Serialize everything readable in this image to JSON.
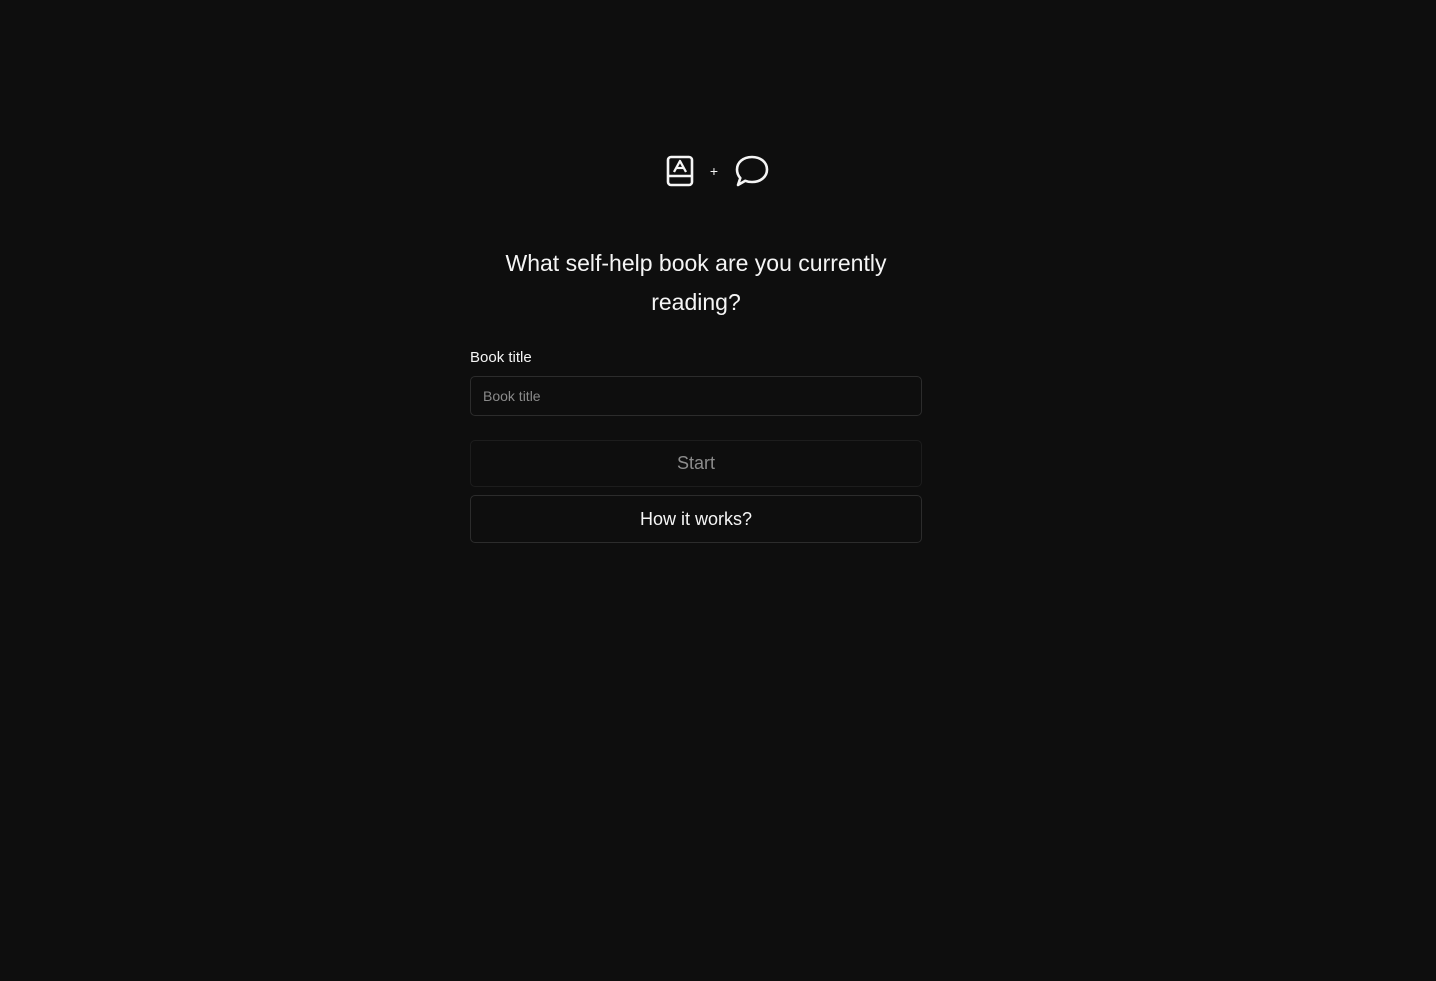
{
  "hero": {
    "icons": [
      "book-icon",
      "chat-bubble-icon"
    ],
    "plus": "+"
  },
  "heading": "What self-help book are you currently reading?",
  "form": {
    "label": "Book title",
    "placeholder": "Book title",
    "value": ""
  },
  "buttons": {
    "start": "Start",
    "how": "How it works?"
  },
  "colors": {
    "background": "#0e0e0e",
    "text": "#f5f5f5",
    "muted_text": "#8c8c8c",
    "border": "#2c2c2c"
  }
}
